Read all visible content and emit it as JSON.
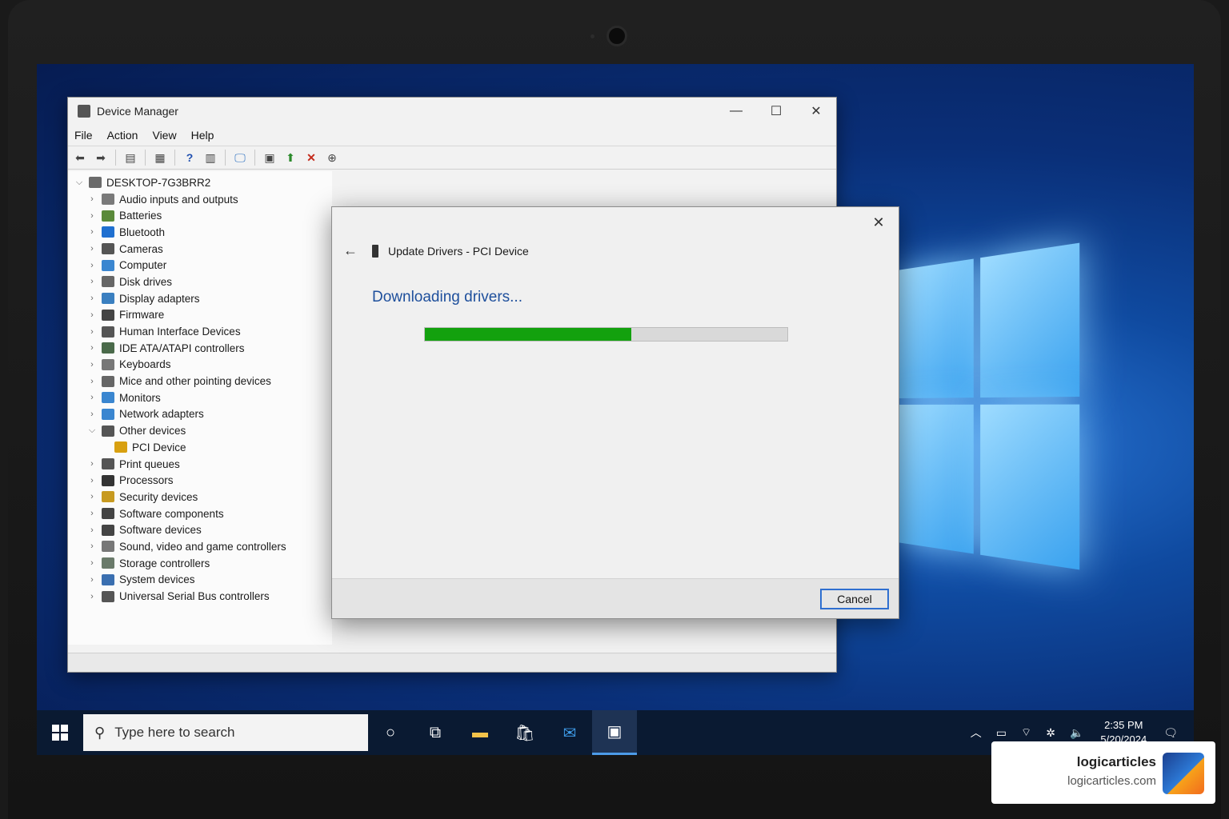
{
  "device_manager": {
    "title": "Device Manager",
    "menu": [
      "File",
      "Action",
      "View",
      "Help"
    ],
    "root": "DESKTOP-7G3BRR2",
    "tree": [
      {
        "label": "Audio inputs and outputs",
        "icon": "speaker-icon",
        "expanded": false
      },
      {
        "label": "Batteries",
        "icon": "battery-icon",
        "expanded": false
      },
      {
        "label": "Bluetooth",
        "icon": "bluetooth-icon",
        "expanded": false
      },
      {
        "label": "Cameras",
        "icon": "camera-icon",
        "expanded": false
      },
      {
        "label": "Computer",
        "icon": "monitor-icon",
        "expanded": false
      },
      {
        "label": "Disk drives",
        "icon": "disk-icon",
        "expanded": false
      },
      {
        "label": "Display adapters",
        "icon": "display-adapter-icon",
        "expanded": false
      },
      {
        "label": "Firmware",
        "icon": "chip-icon",
        "expanded": false
      },
      {
        "label": "Human Interface Devices",
        "icon": "hid-icon",
        "expanded": false
      },
      {
        "label": "IDE ATA/ATAPI controllers",
        "icon": "ide-icon",
        "expanded": false
      },
      {
        "label": "Keyboards",
        "icon": "keyboard-icon",
        "expanded": false
      },
      {
        "label": "Mice and other pointing devices",
        "icon": "mouse-icon",
        "expanded": false
      },
      {
        "label": "Monitors",
        "icon": "monitor-icon",
        "expanded": false
      },
      {
        "label": "Network adapters",
        "icon": "network-icon",
        "expanded": false
      },
      {
        "label": "Other devices",
        "icon": "unknown-device-icon",
        "expanded": true
      },
      {
        "label": "PCI Device",
        "icon": "warning-device-icon",
        "child": true
      },
      {
        "label": "Print queues",
        "icon": "printer-icon",
        "expanded": false
      },
      {
        "label": "Processors",
        "icon": "cpu-icon",
        "expanded": false
      },
      {
        "label": "Security devices",
        "icon": "security-icon",
        "expanded": false
      },
      {
        "label": "Software components",
        "icon": "software-icon",
        "expanded": false
      },
      {
        "label": "Software devices",
        "icon": "software-icon",
        "expanded": false
      },
      {
        "label": "Sound, video and game controllers",
        "icon": "sound-icon",
        "expanded": false
      },
      {
        "label": "Storage controllers",
        "icon": "storage-icon",
        "expanded": false
      },
      {
        "label": "System devices",
        "icon": "system-icon",
        "expanded": false
      },
      {
        "label": "Universal Serial Bus controllers",
        "icon": "usb-icon",
        "expanded": false
      }
    ]
  },
  "dialog": {
    "title": "Update Drivers - PCI Device",
    "message": "Downloading drivers...",
    "progress_fraction": 0.57,
    "cancel_label": "Cancel"
  },
  "taskbar": {
    "search_placeholder": "Type here to search",
    "time": "2:35 PM",
    "date": "5/20/2024"
  },
  "watermark": {
    "name": "logicarticles",
    "url": "logicarticles.com"
  },
  "colors": {
    "progress": "#13a10e",
    "accent": "#1e4f9c",
    "desktop": "#0a2f78"
  }
}
